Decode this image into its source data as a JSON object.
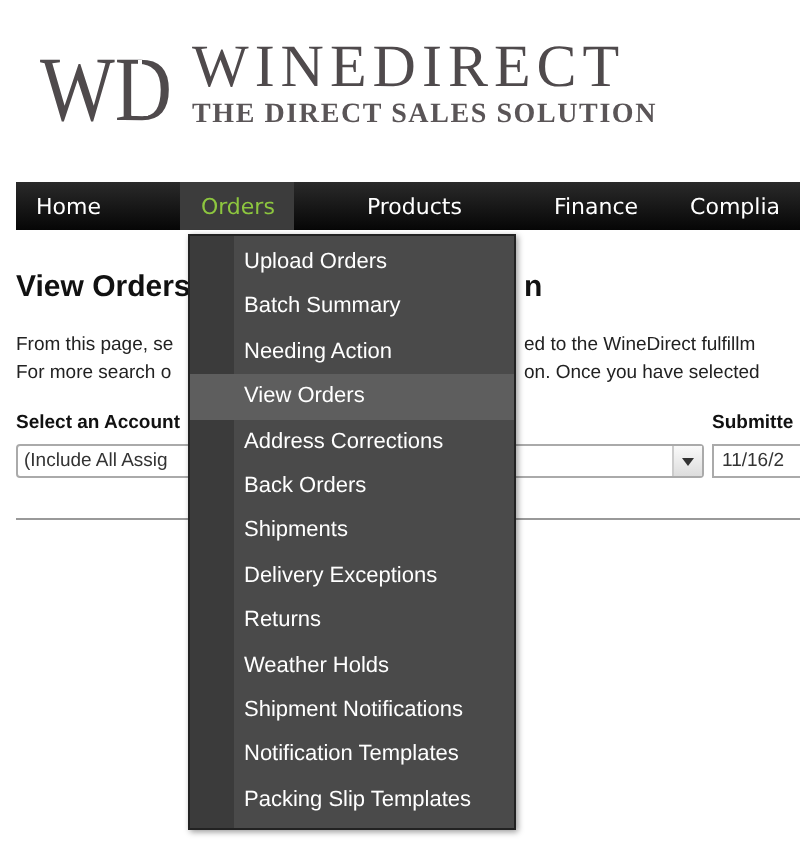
{
  "logo": {
    "mark": "WD",
    "name": "WINEDIRECT",
    "tagline": "THE DIRECT SALES SOLUTION"
  },
  "nav": [
    {
      "label": "Home",
      "selected": false
    },
    {
      "label": "Orders",
      "selected": true
    },
    {
      "label": "Products",
      "selected": false
    },
    {
      "label": "Finance",
      "selected": false
    },
    {
      "label": "Complia",
      "selected": false
    }
  ],
  "menu": [
    {
      "label": "Upload Orders",
      "selected": false
    },
    {
      "label": "Batch Summary",
      "selected": false
    },
    {
      "label": "Needing Action",
      "selected": false
    },
    {
      "label": "View Orders",
      "selected": true
    },
    {
      "label": "Address Corrections",
      "selected": false
    },
    {
      "label": "Back Orders",
      "selected": false
    },
    {
      "label": "Shipments",
      "selected": false
    },
    {
      "label": "Delivery Exceptions",
      "selected": false
    },
    {
      "label": "Returns",
      "selected": false
    },
    {
      "label": "Weather Holds",
      "selected": false
    },
    {
      "label": "Shipment Notifications",
      "selected": false
    },
    {
      "label": "Notification Templates",
      "selected": false
    },
    {
      "label": "Packing Slip Templates",
      "selected": false
    }
  ],
  "page": {
    "heading_left": "View Orders",
    "heading_right": "n",
    "intro": [
      {
        "left": "From this page, se",
        "right": "ed to the WineDirect fulfillm"
      },
      {
        "left": "For more search o",
        "right": "on. Once you have selected"
      }
    ],
    "account_label": "Select an Account",
    "account_value": "(Include All Assig",
    "date_label": "Submitte",
    "date_value": "11/16/2"
  }
}
